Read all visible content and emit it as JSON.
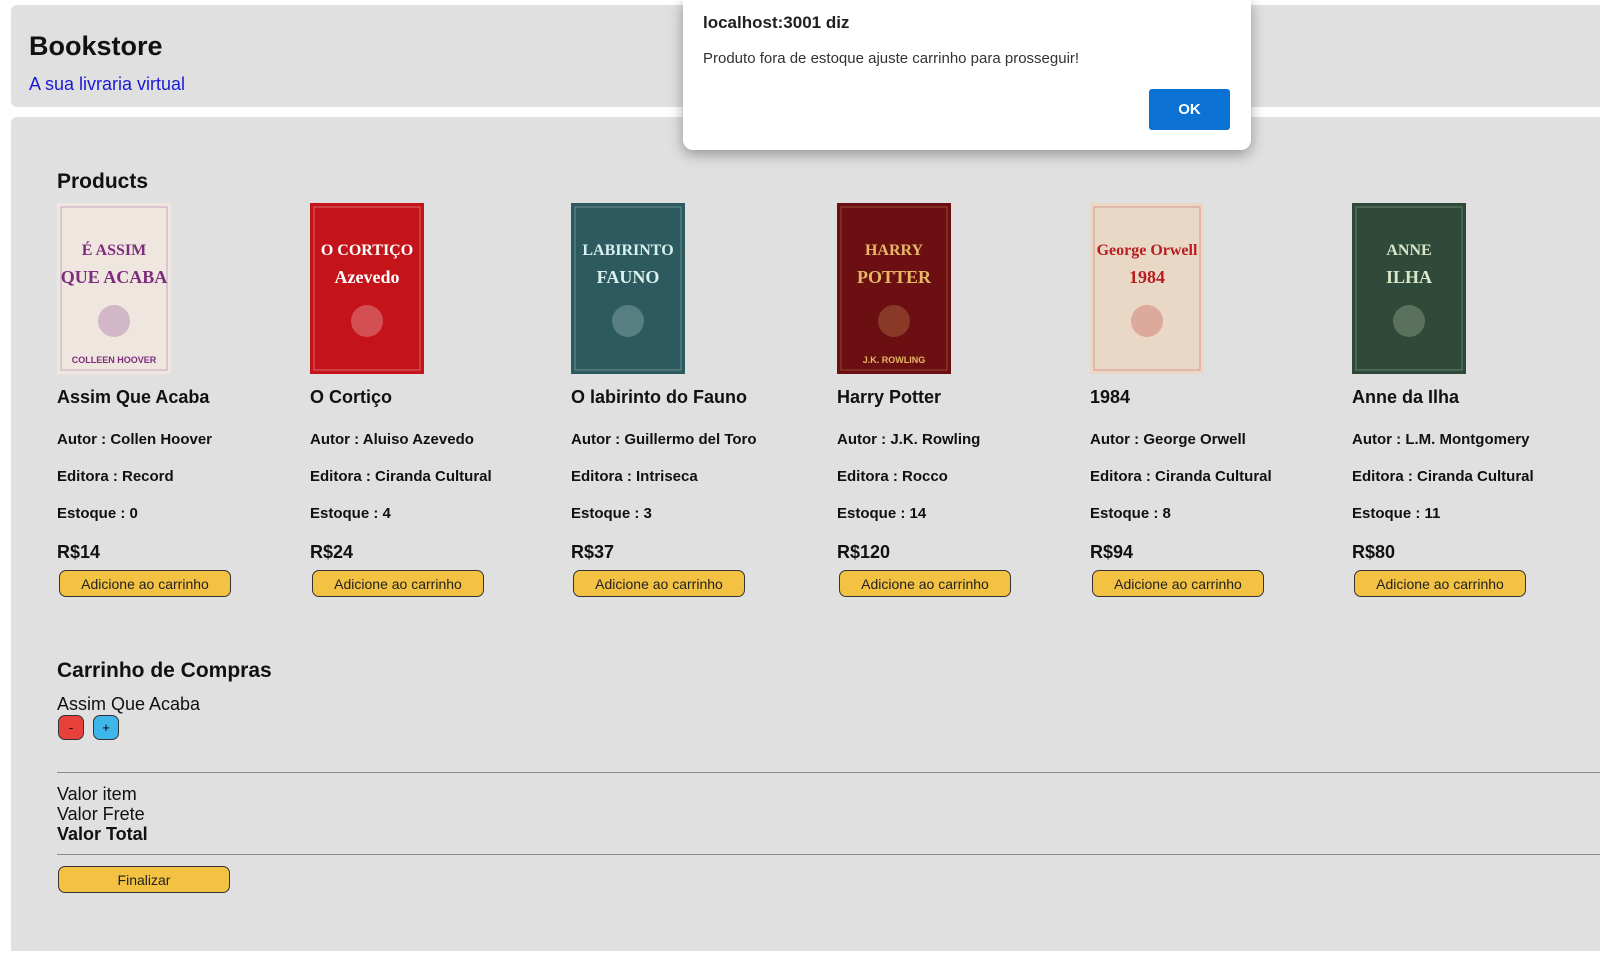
{
  "header": {
    "title": "Bookstore",
    "subtitle": "A sua livraria virtual"
  },
  "products_section": {
    "title": "Products",
    "author_label": "Autor : ",
    "publisher_label": "Editora : ",
    "stock_label": "Estoque : ",
    "currency": "R$",
    "add_button_label": "Adicione ao carrinho"
  },
  "products": [
    {
      "title": "Assim Que Acaba",
      "author": "Collen Hoover",
      "publisher": "Record",
      "stock": "0",
      "price": "14",
      "cover": {
        "bg": "#efe6df",
        "accent": "#7c2d7b",
        "line1": "É ASSIM",
        "line2": "QUE ACABA",
        "footer": "COLLEEN HOOVER"
      }
    },
    {
      "title": "O Cortiço",
      "author": "Aluiso Azevedo",
      "publisher": "Ciranda Cultural",
      "stock": "4",
      "price": "24",
      "cover": {
        "bg": "#c4141a",
        "accent": "#ffffff",
        "line1": "O CORTIÇO",
        "line2": "Azevedo",
        "footer": ""
      }
    },
    {
      "title": "O labirinto do Fauno",
      "author": "Guillermo del Toro",
      "publisher": "Intriseca",
      "stock": "3",
      "price": "37",
      "cover": {
        "bg": "#2d5a5e",
        "accent": "#d8f0ee",
        "line1": "LABIRINTO",
        "line2": "FAUNO",
        "footer": ""
      }
    },
    {
      "title": "Harry Potter",
      "author": "J.K. Rowling",
      "publisher": "Rocco",
      "stock": "14",
      "price": "120",
      "cover": {
        "bg": "#6b0f12",
        "accent": "#e6b866",
        "line1": "HARRY",
        "line2": "POTTER",
        "footer": "J.K. ROWLING"
      }
    },
    {
      "title": "1984",
      "author": "George Orwell",
      "publisher": "Ciranda Cultural",
      "stock": "8",
      "price": "94",
      "cover": {
        "bg": "#ead8c6",
        "accent": "#b81d1f",
        "line1": "George Orwell",
        "line2": "1984",
        "footer": ""
      }
    },
    {
      "title": "Anne da Ilha",
      "author": "L.M. Montgomery",
      "publisher": "Ciranda Cultural",
      "stock": "11",
      "price": "80",
      "cover": {
        "bg": "#2f4a3a",
        "accent": "#d9e6c8",
        "line1": "ANNE",
        "line2": "ILHA",
        "footer": ""
      }
    }
  ],
  "cart": {
    "title": "Carrinho de Compras",
    "items": [
      {
        "title": "Assim Que Acaba"
      }
    ],
    "minus_label": "-",
    "plus_label": "+",
    "item_value_label": "Valor item",
    "shipping_label": "Valor Frete",
    "total_label": "Valor Total",
    "finalize_label": "Finalizar"
  },
  "dialog": {
    "title": "localhost:3001 diz",
    "message": "Produto fora de estoque ajuste carrinho para prosseguir!",
    "ok_label": "OK"
  },
  "colors": {
    "panel_bg": "#e0e0e0",
    "button_yellow": "#f4c242",
    "minus_red": "#e8403a",
    "plus_blue": "#3fb6ea",
    "link_blue": "#1a1ad6",
    "dialog_ok_blue": "#0b72d3"
  }
}
